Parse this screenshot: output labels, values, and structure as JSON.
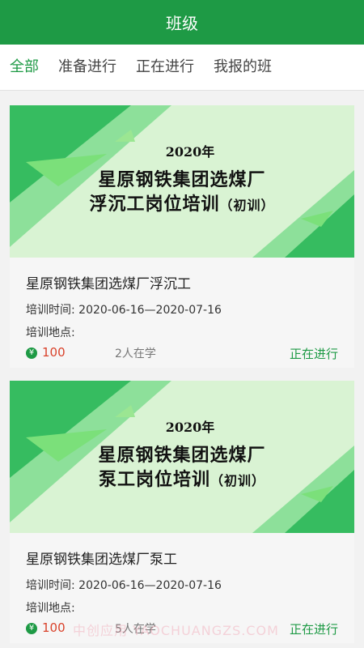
{
  "header": {
    "title": "班级"
  },
  "tabs": [
    {
      "label": "全部",
      "active": true
    },
    {
      "label": "准备进行",
      "active": false
    },
    {
      "label": "正在进行",
      "active": false
    },
    {
      "label": "我报的班",
      "active": false
    }
  ],
  "classes": [
    {
      "banner": {
        "year": "2020年",
        "line1": "星原钢铁集团选煤厂",
        "line2": "浮沉工岗位培训",
        "line2_suffix": "（初训）"
      },
      "title": "星原钢铁集团选煤厂浮沉工",
      "time_label": "培训时间:",
      "time_value": "2020-06-16—2020-07-16",
      "place_label": "培训地点:",
      "price": "100",
      "learners": "2人在学",
      "status": "正在进行"
    },
    {
      "banner": {
        "year": "2020年",
        "line1": "星原钢铁集团选煤厂",
        "line2": "泵工岗位培训",
        "line2_suffix": "（初训）"
      },
      "title": "星原钢铁集团选煤厂泵工",
      "time_label": "培训时间:",
      "time_value": "2020-06-16—2020-07-16",
      "place_label": "培训地点:",
      "price": "100",
      "learners": "5人在学",
      "status": "正在进行"
    }
  ],
  "coin_icon": "¥",
  "watermark": "中创应用   YAOCHUANGZS.COM",
  "colors": {
    "accent": "#1e9a45",
    "price": "#d9422b",
    "banner_bg": "#d9f3d3"
  }
}
